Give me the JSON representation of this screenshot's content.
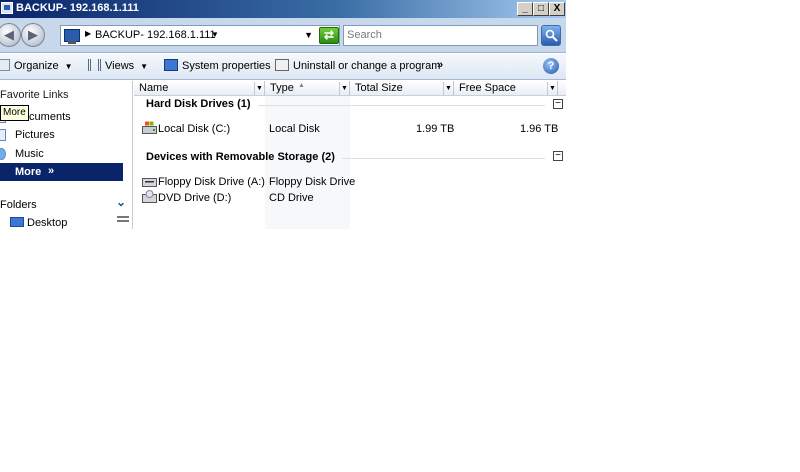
{
  "window": {
    "title": "BACKUP- 192.168.1.111"
  },
  "caption_buttons": {
    "minimize": "_",
    "maximize": "□",
    "close": "X"
  },
  "nav": {
    "back_icon": "back-arrow-icon",
    "forward_icon": "forward-arrow-icon",
    "address": "BACKUP- 192.168.1.111",
    "search_placeholder": "Search"
  },
  "toolbar": {
    "organize": "Organize",
    "views": "Views",
    "system_properties": "System properties",
    "uninstall": "Uninstall or change a program",
    "overflow": "»"
  },
  "sidebar": {
    "favorites_title": "Favorite Links",
    "items": [
      {
        "label": "Documents"
      },
      {
        "label": "Pictures"
      },
      {
        "label": "Music"
      }
    ],
    "more_label": "More",
    "more_chevron": "»",
    "tooltip": "More",
    "folders_title": "Folders",
    "desktop_label": "Desktop"
  },
  "columns": [
    {
      "label": "Name"
    },
    {
      "label": "Type"
    },
    {
      "label": "Total Size"
    },
    {
      "label": "Free Space"
    }
  ],
  "groups": [
    {
      "title": "Hard Disk Drives (1)",
      "items": [
        {
          "name": "Local Disk (C:)",
          "type": "Local Disk",
          "total": "1.99 TB",
          "free": "1.96 TB",
          "icon": "hard-disk-icon"
        }
      ]
    },
    {
      "title": "Devices with Removable Storage (2)",
      "items": [
        {
          "name": "Floppy Disk Drive (A:)",
          "type": "Floppy Disk Drive",
          "total": "",
          "free": "",
          "icon": "floppy-drive-icon"
        },
        {
          "name": "DVD Drive (D:)",
          "type": "CD Drive",
          "total": "",
          "free": "",
          "icon": "dvd-drive-icon"
        }
      ]
    }
  ],
  "collapse_glyph": "−"
}
